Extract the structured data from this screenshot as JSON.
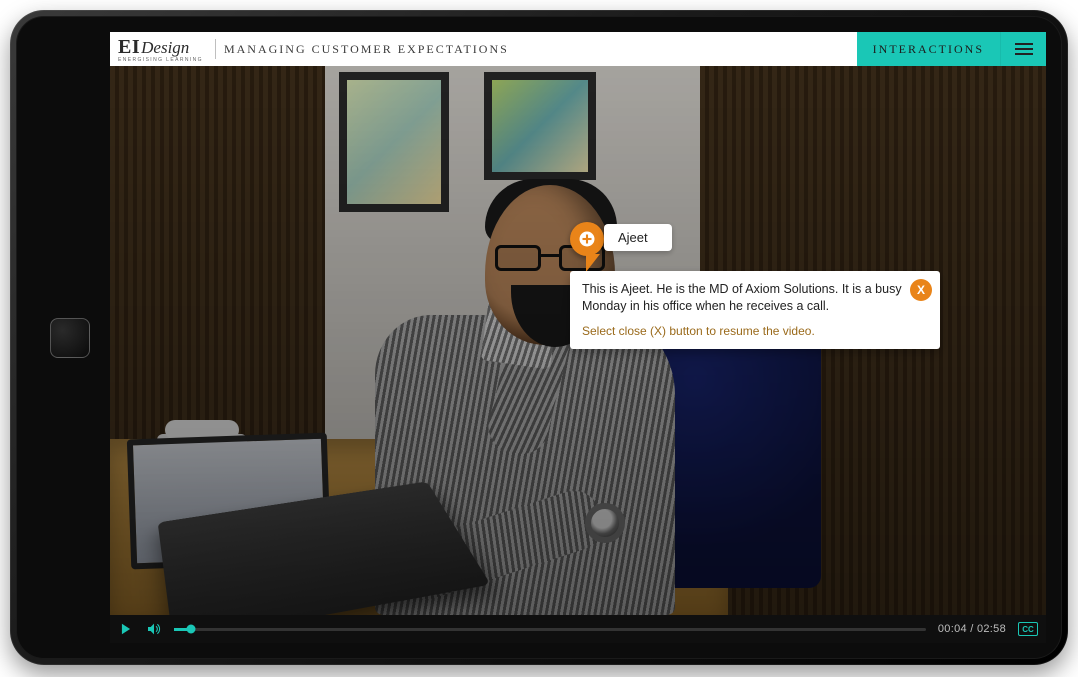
{
  "brand": {
    "l1": "EI",
    "l2": "Design",
    "tag": "ENERGISING LEARNING"
  },
  "header": {
    "title": "MANAGING CUSTOMER EXPECTATIONS",
    "interactions_label": "INTERACTIONS"
  },
  "hotspot": {
    "name": "Ajeet",
    "card_text": "This is Ajeet. He is the MD of Axiom Solutions. It is a busy Monday in his office when he receives a call.",
    "card_hint": "Select close (X) button to resume the video.",
    "close_glyph": "X"
  },
  "player": {
    "elapsed": "00:04",
    "total": "02:58",
    "time_display": "00:04 / 02:58",
    "progress_pct": 2.2,
    "cc_label": "CC"
  },
  "colors": {
    "accent": "#1ac7b6",
    "hotspot": "#e98419"
  }
}
